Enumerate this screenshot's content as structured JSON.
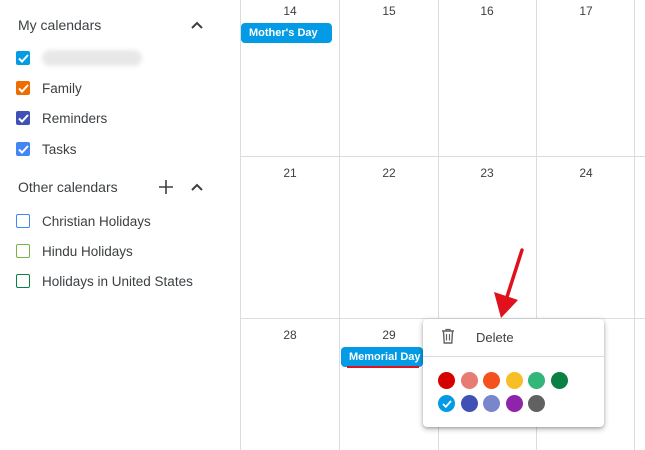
{
  "sidebar": {
    "my_calendars": {
      "title": "My calendars",
      "items": [
        {
          "label": "",
          "color": "#039be5",
          "checked": true,
          "blurred": true
        },
        {
          "label": "Family",
          "color": "#ef6c00",
          "checked": true
        },
        {
          "label": "Reminders",
          "color": "#3f51b5",
          "checked": true
        },
        {
          "label": "Tasks",
          "color": "#4285f4",
          "checked": true
        }
      ]
    },
    "other_calendars": {
      "title": "Other calendars",
      "items": [
        {
          "label": "Christian Holidays",
          "color": "#4285f4",
          "checked": false
        },
        {
          "label": "Hindu Holidays",
          "color": "#7cb342",
          "checked": false
        },
        {
          "label": "Holidays in United States",
          "color": "#0b8043",
          "checked": false
        }
      ]
    }
  },
  "grid": {
    "rows": [
      [
        "14",
        "15",
        "16",
        "17"
      ],
      [
        "21",
        "22",
        "23",
        "24"
      ],
      [
        "28",
        "29",
        "",
        ""
      ]
    ],
    "events": {
      "mothers_day": "Mother's Day",
      "memorial_day": "Memorial Day"
    }
  },
  "context_menu": {
    "delete_label": "Delete",
    "colors_row1": [
      "#d50000",
      "#e67c73",
      "#f4511e",
      "#f6bf26",
      "#33b679",
      "#0b8043"
    ],
    "colors_row2": [
      "#039be5",
      "#3f51b5",
      "#7986cb",
      "#8e24aa",
      "#616161"
    ],
    "selected_color": "#039be5"
  },
  "annotation_color": "#e0111c"
}
